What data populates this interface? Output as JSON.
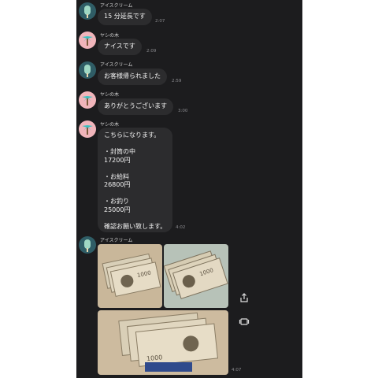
{
  "users": {
    "ice": "アイスクリーム",
    "palm": "ヤシの木"
  },
  "messages": [
    {
      "sender": "ice",
      "text": "15 分延長です",
      "time": "2:07"
    },
    {
      "sender": "palm",
      "text": "ナイスです",
      "time": "2:09"
    },
    {
      "sender": "ice",
      "text": "お客様帰られました",
      "time": "2:59"
    },
    {
      "sender": "palm",
      "text": "ありがとうございます",
      "time": "3:00"
    },
    {
      "sender": "palm",
      "lines": [
        "こちらになります。",
        "",
        "・封筒の中",
        "17200円",
        "",
        "・お給料",
        "26800円",
        "",
        "・お釣り",
        "25000円",
        "",
        "確認お願い致します。"
      ],
      "time": "4:02"
    },
    {
      "sender": "ice",
      "photos": [
        "cash-photo-1",
        "cash-photo-2",
        "cash-photo-3"
      ],
      "time": "4:07"
    }
  ],
  "icons": [
    "share-icon",
    "gallery-icon"
  ],
  "colors": {
    "background": "#1c1c1e",
    "bubble": "#2c2c2e",
    "text": "#f2f2f2",
    "time": "#8a8a8e"
  }
}
